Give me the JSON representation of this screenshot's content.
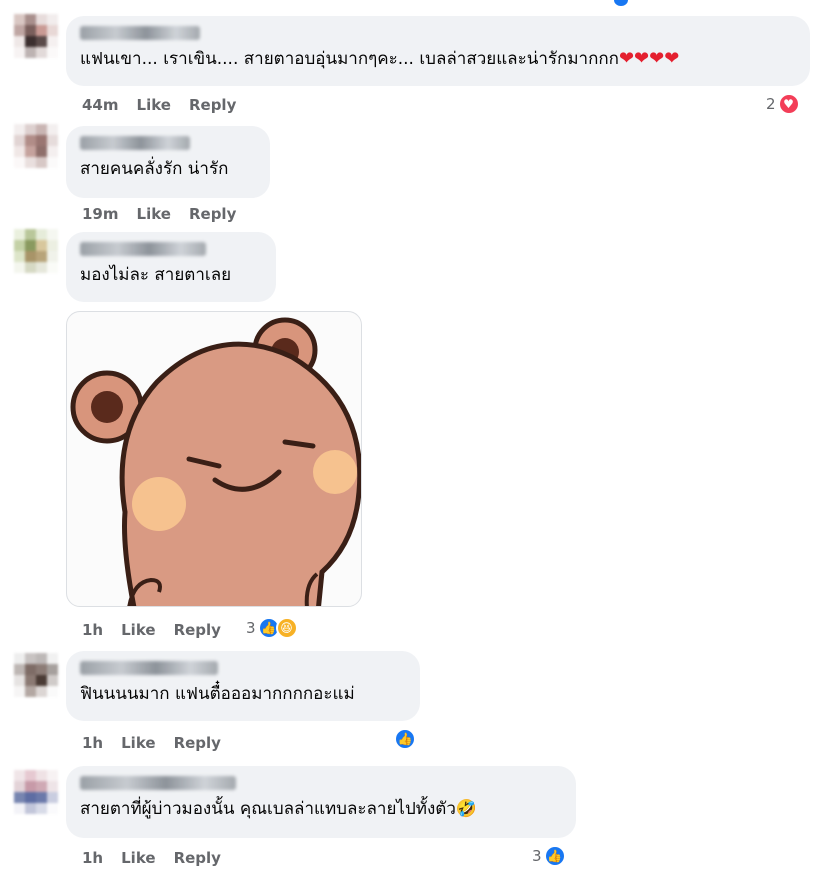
{
  "comments": [
    {
      "text": "แฟนเขา... เราเขิน.... สายตาอบอุ่นมากๆคะ... เบลล่าสวยและน่ารักมากกก",
      "emoji_tail": "❤❤❤❤",
      "time": "44m",
      "like": "Like",
      "reply": "Reply",
      "reaction_count": "2",
      "reaction_icons": [
        "heart-icon"
      ]
    },
    {
      "text": "สายคนคลั่งรัก น่ารัก",
      "time": "19m",
      "like": "Like",
      "reply": "Reply"
    },
    {
      "text": "มองไม่ละ สายตาเลย",
      "sticker": "bear-sticker",
      "time": "1h",
      "like": "Like",
      "reply": "Reply",
      "reaction_count": "3",
      "reaction_icons": [
        "like-icon",
        "haha-icon"
      ]
    },
    {
      "text": "ฟินนนนมาก แฟนตื๋อออมากกกกอะแม่",
      "time": "1h",
      "like": "Like",
      "reply": "Reply",
      "reaction_icons": [
        "like-icon"
      ]
    },
    {
      "text": "สายตาที่ผู้บ่าวมองนั้น คุณเบลล่าแทบละลายไปทั้งตัว",
      "emoji_tail": "🤣",
      "time": "1h",
      "like": "Like",
      "reply": "Reply",
      "reaction_count": "3",
      "reaction_icons": [
        "like-icon"
      ]
    }
  ],
  "colors": {
    "bubble": "#f0f2f5",
    "like_blue": "#1877f2",
    "heart_red": "#f33e58",
    "meta_gray": "#65676b"
  }
}
